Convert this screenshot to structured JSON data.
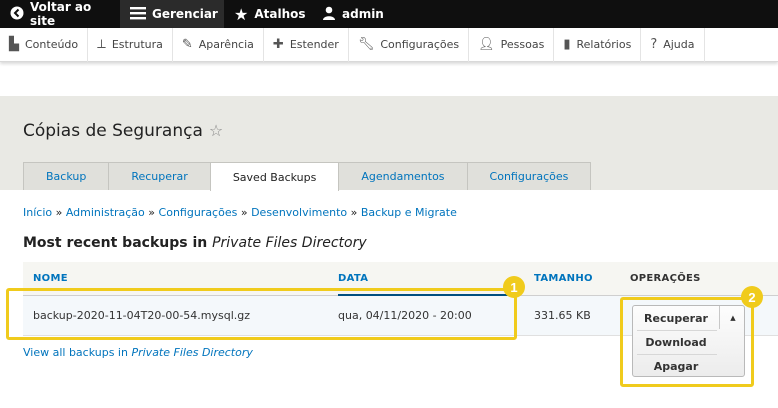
{
  "topbar": {
    "items": [
      {
        "label": "Voltar ao site",
        "icon": "back-circle-icon"
      },
      {
        "label": "Gerenciar",
        "icon": "menu-icon"
      },
      {
        "label": "Atalhos",
        "icon": "star-icon"
      },
      {
        "label": "admin",
        "icon": "user-icon"
      }
    ]
  },
  "toolbar": {
    "items": [
      {
        "label": "Conteúdo",
        "icon": "content-icon"
      },
      {
        "label": "Estrutura",
        "icon": "structure-icon"
      },
      {
        "label": "Aparência",
        "icon": "appearance-icon"
      },
      {
        "label": "Estender",
        "icon": "extend-icon"
      },
      {
        "label": "Configurações",
        "icon": "wrench-icon"
      },
      {
        "label": "Pessoas",
        "icon": "people-icon"
      },
      {
        "label": "Relatórios",
        "icon": "reports-icon"
      },
      {
        "label": "Ajuda",
        "icon": "help-icon"
      }
    ]
  },
  "page": {
    "title": "Cópias de Segurança"
  },
  "tabs": [
    "Backup",
    "Recuperar",
    "Saved Backups",
    "Agendamentos",
    "Configurações"
  ],
  "breadcrumb": [
    "Início",
    "Administração",
    "Configurações",
    "Desenvolvimento",
    "Backup e Migrate"
  ],
  "section": {
    "title_prefix": "Most recent backups in ",
    "title_em": "Private Files Directory"
  },
  "table": {
    "headers": {
      "name": "NOME",
      "date": "DATA",
      "size": "TAMANHO",
      "ops": "OPERAÇÕES"
    },
    "row": {
      "name": "backup-2020-11-04T20-00-54.mysql.gz",
      "date": "qua, 04/11/2020 - 20:00",
      "size": "331.65 KB"
    }
  },
  "operations": [
    "Recuperar",
    "Download",
    "Apagar"
  ],
  "view_all": {
    "prefix": "View all backups in ",
    "em": "Private Files Directory"
  },
  "badges": [
    "1",
    "2"
  ],
  "colors": {
    "link": "#0074bd",
    "highlight": "#f0cb1c",
    "topbar": "#0f0f0f"
  }
}
